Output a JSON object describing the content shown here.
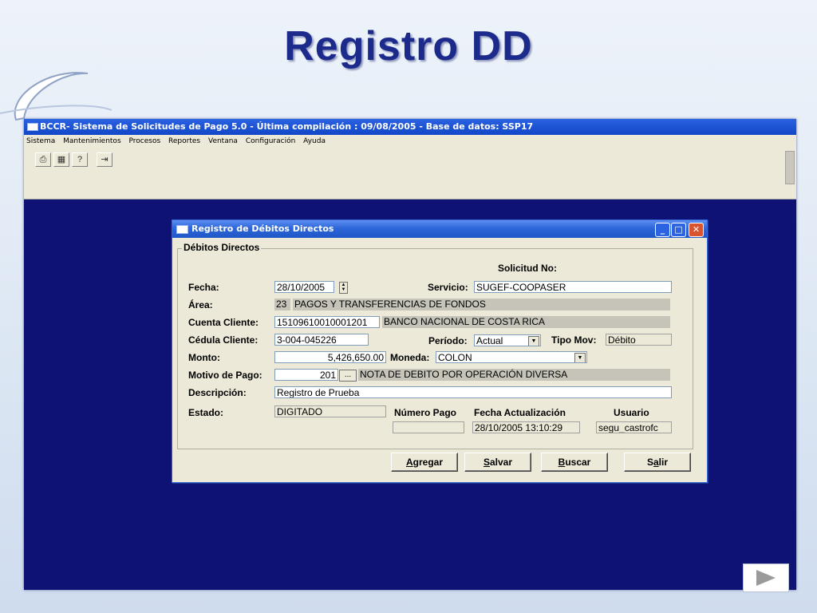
{
  "slide": {
    "title": "Registro DD"
  },
  "app": {
    "title": "BCCR- Sistema de Solicitudes de Pago 5.0 - Última compilación : 09/08/2005 - Base de datos: SSP17",
    "menu": [
      "Sistema",
      "Mantenimientos",
      "Procesos",
      "Reportes",
      "Ventana",
      "Configuración",
      "Ayuda"
    ],
    "toolbar": [
      "printer-icon",
      "preview-icon",
      "help-icon",
      "exit-icon"
    ]
  },
  "dialog": {
    "title": "Registro de Débitos Directos",
    "group_label": "Débitos Directos",
    "solicitud_label": "Solicitud No:",
    "fields": {
      "fecha_label": "Fecha:",
      "fecha": "28/10/2005",
      "servicio_label": "Servicio:",
      "servicio": "SUGEF-COOPASER",
      "area_label": "Área:",
      "area_code": "23",
      "area_name": "PAGOS Y TRANSFERENCIAS DE FONDOS",
      "cuenta_label": "Cuenta Cliente:",
      "cuenta": "15109610010001201",
      "banco": "BANCO NACIONAL DE COSTA RICA",
      "cedula_label": "Cédula Cliente:",
      "cedula": "3-004-045226",
      "periodo_label": "Período:",
      "periodo": "Actual",
      "tipomov_label": "Tipo Mov:",
      "tipomov": "Débito",
      "monto_label": "Monto:",
      "monto": "5,426,650.00",
      "moneda_label": "Moneda:",
      "moneda": "COLON",
      "motivo_label": "Motivo de Pago:",
      "motivo_code": "201",
      "motivo_desc": "NOTA DE DEBITO POR OPERACIÓN DIVERSA",
      "motivo_btn": "...",
      "descripcion_label": "Descripción:",
      "descripcion": "Registro de Prueba",
      "estado_label": "Estado:",
      "estado": "DIGITADO",
      "numero_pago_label": "Número Pago",
      "numero_pago": "",
      "fecha_act_label": "Fecha Actualización",
      "fecha_act": "28/10/2005 13:10:29",
      "usuario_label": "Usuario",
      "usuario": "segu_castrofc"
    },
    "buttons": {
      "agregar": {
        "u": "A",
        "rest": "gregar"
      },
      "salvar": {
        "u": "S",
        "rest": "alvar"
      },
      "buscar": {
        "u": "B",
        "rest": "uscar"
      },
      "salir": {
        "pre": "S",
        "u": "a",
        "rest": "lir"
      }
    }
  }
}
